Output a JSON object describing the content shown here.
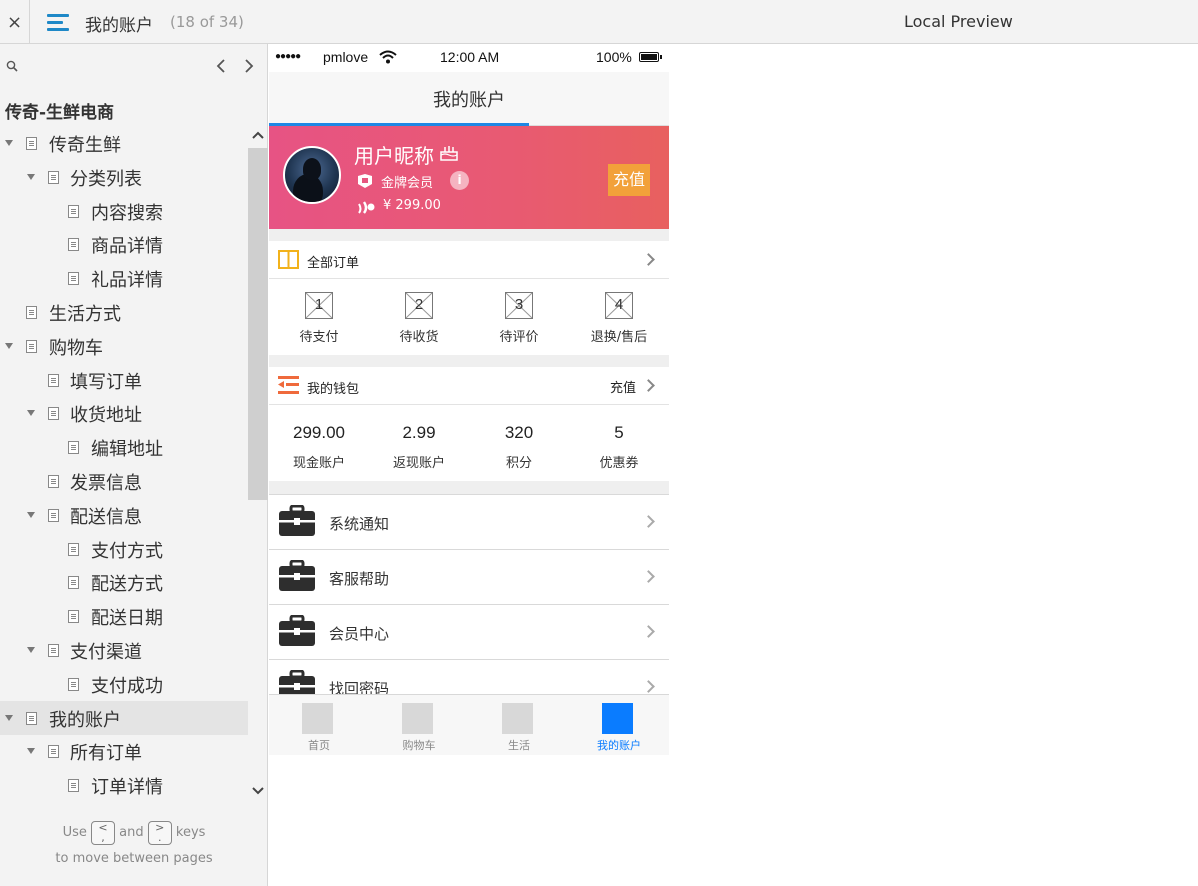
{
  "topbar": {
    "close_glyph": "×",
    "page_title": "我的账户",
    "page_count": "(18 of 34)",
    "preview_label": "Local Preview"
  },
  "sidebar": {
    "project_title": "传奇-生鲜电商",
    "tree": [
      {
        "label": "传奇生鲜",
        "level": 0,
        "expanded": true
      },
      {
        "label": "分类列表",
        "level": 1,
        "expanded": true
      },
      {
        "label": "内容搜索",
        "level": 2
      },
      {
        "label": "商品详情",
        "level": 2
      },
      {
        "label": "礼品详情",
        "level": 2
      },
      {
        "label": "生活方式",
        "level": 0
      },
      {
        "label": "购物车",
        "level": 0,
        "expanded": true
      },
      {
        "label": "填写订单",
        "level": 1
      },
      {
        "label": "收货地址",
        "level": 1,
        "expanded": true
      },
      {
        "label": "编辑地址",
        "level": 2
      },
      {
        "label": "发票信息",
        "level": 1
      },
      {
        "label": "配送信息",
        "level": 1,
        "expanded": true
      },
      {
        "label": "支付方式",
        "level": 2
      },
      {
        "label": "配送方式",
        "level": 2
      },
      {
        "label": "配送日期",
        "level": 2
      },
      {
        "label": "支付渠道",
        "level": 1,
        "expanded": true
      },
      {
        "label": "支付成功",
        "level": 2
      },
      {
        "label": "我的账户",
        "level": 0,
        "expanded": true,
        "selected": true
      },
      {
        "label": "所有订单",
        "level": 1,
        "expanded": true
      },
      {
        "label": "订单详情",
        "level": 2
      }
    ],
    "hint": {
      "use": "Use",
      "and": "and",
      "keys": "keys",
      "line2": "to move between pages",
      "prev_key": "<",
      "prev_key_sub": ",",
      "next_key": ">",
      "next_key_sub": "."
    }
  },
  "phone": {
    "status": {
      "signal": "●●●●●",
      "carrier": "pmlove",
      "time": "12:00 AM",
      "battery": "100%"
    },
    "nav_title": "我的账户",
    "profile": {
      "nickname": "用户昵称",
      "level": "金牌会员",
      "info_glyph": "i",
      "balance": "¥  299.00",
      "recharge": "充值"
    },
    "orders_header": "全部订单",
    "orders": [
      {
        "num": "1",
        "label": "待支付"
      },
      {
        "num": "2",
        "label": "待收货"
      },
      {
        "num": "3",
        "label": "待评价"
      },
      {
        "num": "4",
        "label": "退换/售后"
      }
    ],
    "wallet_header": "我的钱包",
    "wallet_recharge": "充值",
    "wallet": [
      {
        "value": "299.00",
        "label": "现金账户"
      },
      {
        "value": "2.99",
        "label": "返现账户"
      },
      {
        "value": "320",
        "label": "积分"
      },
      {
        "value": "5",
        "label": "优惠券"
      }
    ],
    "menu": [
      {
        "label": "系统通知"
      },
      {
        "label": "客服帮助"
      },
      {
        "label": "会员中心"
      },
      {
        "label": "找回密码"
      }
    ],
    "tabs": [
      {
        "label": "首页"
      },
      {
        "label": "购物车"
      },
      {
        "label": "生活"
      },
      {
        "label": "我的账户",
        "active": true
      }
    ]
  },
  "colors": {
    "accent": "#1e88e5",
    "profile_gradient_start": "#e75384",
    "profile_gradient_end": "#e8605f",
    "recharge_button": "#f2a13a",
    "tab_active": "#0a7cff"
  }
}
